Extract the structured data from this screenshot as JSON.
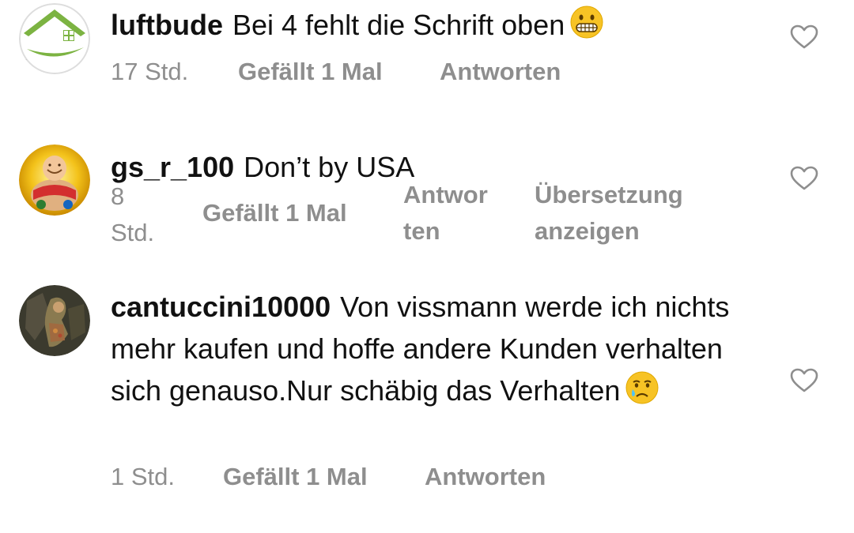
{
  "comments": [
    {
      "username": "luftbude",
      "text": "Bei 4 fehlt die Schrift oben",
      "emoji": "grimacing-face",
      "time": "17 Std.",
      "likes": "Gefällt 1 Mal",
      "reply": "Antworten"
    },
    {
      "username": "gs_r_100",
      "text": "Don’t by USA",
      "time_line1": "8",
      "time_line2": "Std.",
      "likes": "Gefällt 1 Mal",
      "reply_line1": "Antwor",
      "reply_line2": "ten",
      "translate_line1": "Übersetzung",
      "translate_line2": "anzeigen"
    },
    {
      "username": "cantuccini10000",
      "text": "Von vissmann werde ich nichts mehr kaufen und hoffe andere Kunden verhalten sich genauso.Nur schäbig das Verhalten",
      "emoji": "crying-face",
      "time": "1 Std.",
      "likes": "Gefällt 1 Mal",
      "reply": "Antworten"
    }
  ],
  "colors": {
    "text": "#111111",
    "meta": "#8e8e8e",
    "heart": "#8e8e8e",
    "background": "#ffffff"
  }
}
